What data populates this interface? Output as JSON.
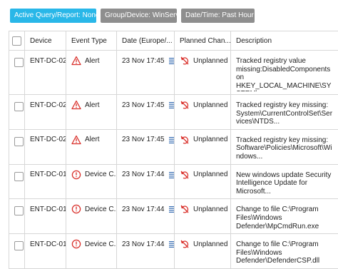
{
  "filters": {
    "active": "Active Query/Report: None",
    "group": "Group/Device: WinServ",
    "datetime": "Date/Time: Past Hour"
  },
  "colors": {
    "accent": "#29b7e8",
    "chip_grey": "#8e8e8e",
    "alert_red": "#d9302b",
    "date_icon_blue": "#3b6fb3"
  },
  "table": {
    "headers": {
      "device": "Device",
      "event_type": "Event Type",
      "date": "Date (Europe/...",
      "planned": "Planned Chan...",
      "description": "Description"
    },
    "rows": [
      {
        "device": "ENT-DC-02",
        "event_icon": "alert-triangle-icon",
        "event_type": "Alert",
        "date": "23 Nov 17:45",
        "planned_icon": "unplanned-icon",
        "planned": "Unplanned",
        "description": "Tracked registry value missing:DisabledComponents on HKEY_LOCAL_MACHINE\\SYSTEM\\..."
      },
      {
        "device": "ENT-DC-02",
        "event_icon": "alert-triangle-icon",
        "event_type": "Alert",
        "date": "23 Nov 17:45",
        "planned_icon": "unplanned-icon",
        "planned": "Unplanned",
        "description": "Tracked registry key missing: System\\CurrentControlSet\\Services\\NTDS..."
      },
      {
        "device": "ENT-DC-02",
        "event_icon": "alert-triangle-icon",
        "event_type": "Alert",
        "date": "23 Nov 17:45",
        "planned_icon": "unplanned-icon",
        "planned": "Unplanned",
        "description": "Tracked registry key missing: Software\\Policies\\Microsoft\\Windows..."
      },
      {
        "device": "ENT-DC-01",
        "event_icon": "info-circle-icon",
        "event_type": "Device C...",
        "date": "23 Nov 17:44",
        "planned_icon": "unplanned-icon",
        "planned": "Unplanned",
        "description": "New windows update Security Intelligence Update for Microsoft..."
      },
      {
        "device": "ENT-DC-01",
        "event_icon": "info-circle-icon",
        "event_type": "Device C...",
        "date": "23 Nov 17:44",
        "planned_icon": "unplanned-icon",
        "planned": "Unplanned",
        "description": "Change to file C:\\Program Files\\Windows Defender\\MpCmdRun.exe"
      },
      {
        "device": "ENT-DC-01",
        "event_icon": "info-circle-icon",
        "event_type": "Device C...",
        "date": "23 Nov 17:44",
        "planned_icon": "unplanned-icon",
        "planned": "Unplanned",
        "description": "Change to file C:\\Program Files\\Windows Defender\\DefenderCSP.dll"
      }
    ]
  }
}
